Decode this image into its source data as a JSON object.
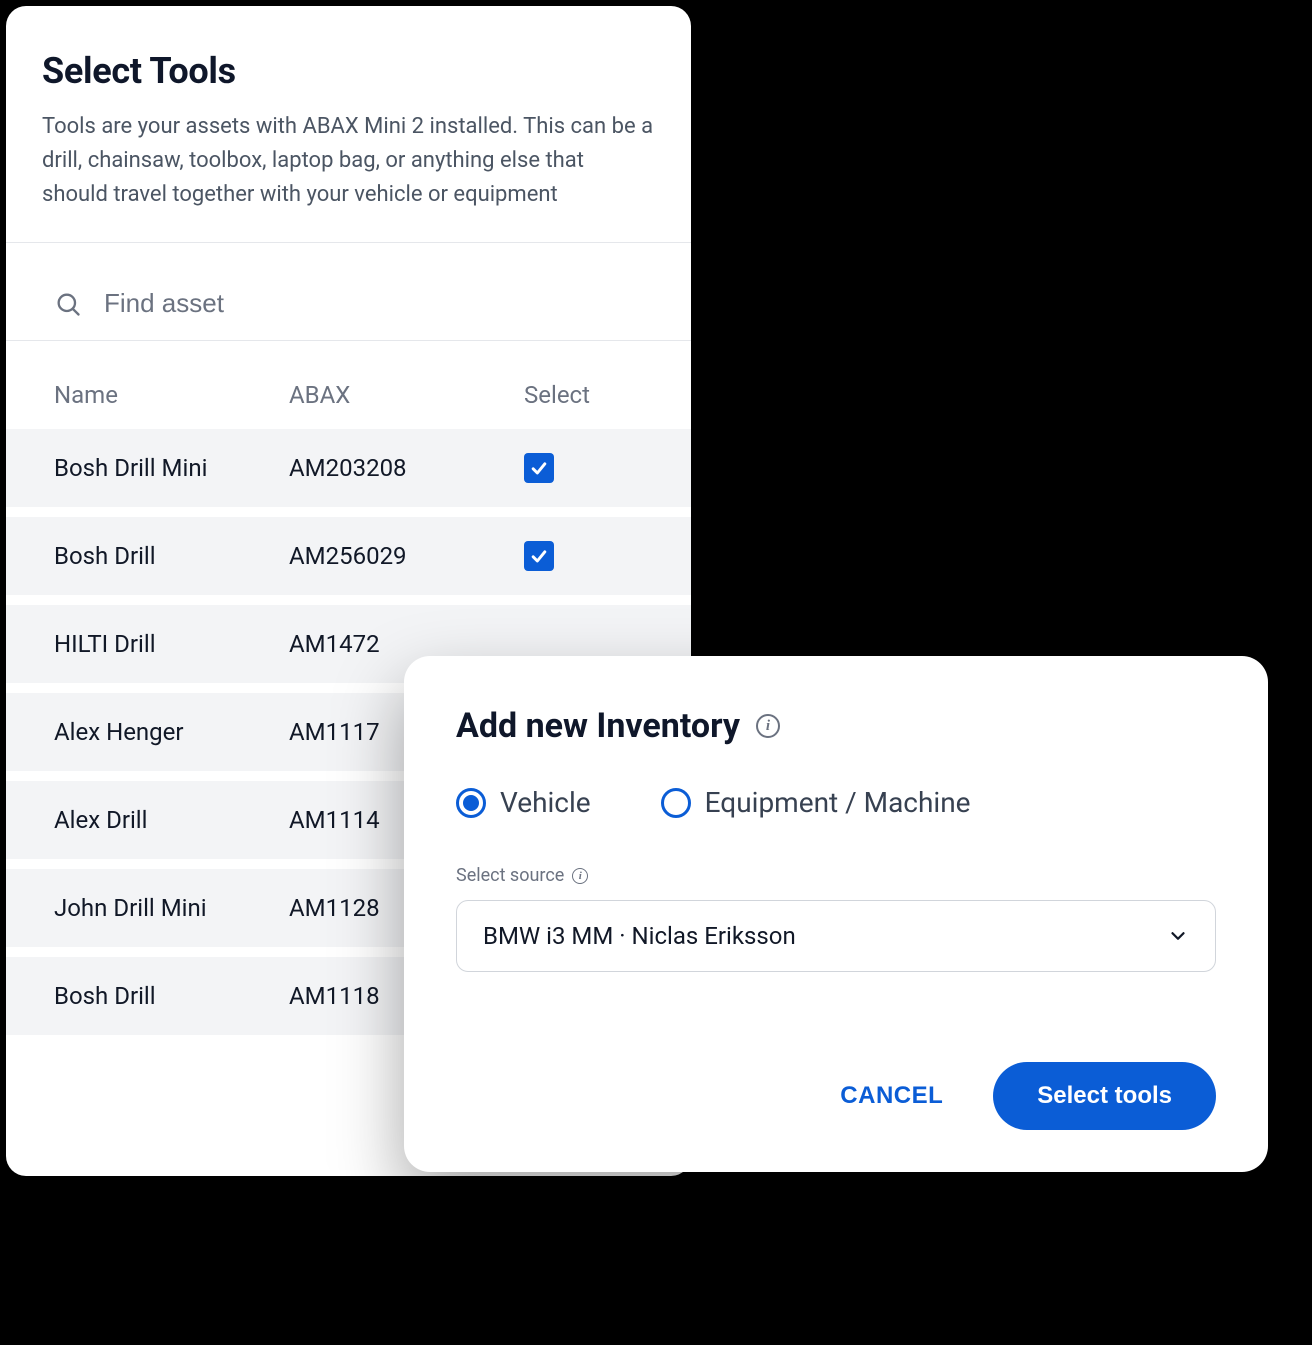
{
  "tools_panel": {
    "title": "Select Tools",
    "description": "Tools are your assets with ABAX Mini 2 installed. This can be a drill, chainsaw, toolbox, laptop bag, or anything else that should travel together with your vehicle or equipment",
    "search_placeholder": "Find asset",
    "columns": {
      "name": "Name",
      "abax": "ABAX",
      "select": "Select"
    },
    "rows": [
      {
        "name": "Bosh Drill Mini",
        "abax": "AM203208",
        "checked": true
      },
      {
        "name": "Bosh Drill",
        "abax": "AM256029",
        "checked": true
      },
      {
        "name": "HILTI Drill",
        "abax": "AM1472",
        "checked": false
      },
      {
        "name": "Alex Henger",
        "abax": "AM1117",
        "checked": false
      },
      {
        "name": "Alex Drill",
        "abax": "AM1114",
        "checked": false
      },
      {
        "name": "John Drill Mini",
        "abax": "AM1128",
        "checked": false
      },
      {
        "name": "Bosh Drill",
        "abax": "AM1118",
        "checked": false
      }
    ]
  },
  "inventory_modal": {
    "title": "Add new Inventory",
    "options": {
      "vehicle": "Vehicle",
      "equipment": "Equipment / Machine",
      "selected": "vehicle"
    },
    "source_label": "Select source",
    "source_value": "BMW i3 MM · Niclas Eriksson",
    "cancel_label": "CANCEL",
    "primary_label": "Select tools"
  }
}
